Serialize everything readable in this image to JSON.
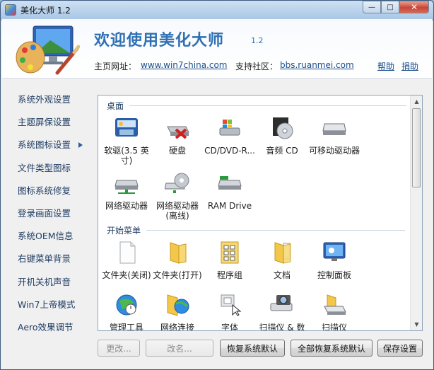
{
  "window": {
    "title": "美化大师 1.2",
    "controls": {
      "minimize": "—",
      "maximize": "□",
      "close": "✕"
    }
  },
  "banner": {
    "title": "欢迎使用美化大师",
    "version": "1.2",
    "home_label": "主页网址：",
    "home_url": "www.win7china.com",
    "community_label": "支持社区：",
    "community_url": "bbs.ruanmei.com",
    "help": "帮助",
    "donate": "捐助"
  },
  "sidebar": {
    "items": [
      {
        "label": "系统外观设置",
        "active": false
      },
      {
        "label": "主题屏保设置",
        "active": false
      },
      {
        "label": "系统图标设置",
        "active": true
      },
      {
        "label": "文件类型图标",
        "active": false
      },
      {
        "label": "图标系统修复",
        "active": false
      },
      {
        "label": "登录画面设置",
        "active": false
      },
      {
        "label": "系统OEM信息",
        "active": false
      },
      {
        "label": "右键菜单背景",
        "active": false
      },
      {
        "label": "开机关机声音",
        "active": false
      },
      {
        "label": "Win7上帝模式",
        "active": false
      },
      {
        "label": "Aero效果调节",
        "active": false
      }
    ]
  },
  "panel": {
    "desktop_section": "桌面",
    "start_section": "开始菜单",
    "desktop_items": [
      {
        "label": "软驱(3.5 英寸)",
        "icon": "floppy-drive-icon"
      },
      {
        "label": "硬盘",
        "icon": "hard-disk-icon"
      },
      {
        "label": "CD/DVD-R...",
        "icon": "cd-dvd-drive-icon"
      },
      {
        "label": "音频 CD",
        "icon": "audio-cd-icon"
      },
      {
        "label": "可移动驱动器",
        "icon": "removable-drive-icon"
      },
      {
        "label": "网络驱动器",
        "icon": "network-drive-icon"
      },
      {
        "label": "网络驱动器(离线)",
        "icon": "offline-network-drive-icon"
      },
      {
        "label": "RAM Drive",
        "icon": "ram-drive-icon"
      }
    ],
    "start_items": [
      {
        "label": "文件夹(关闭)",
        "icon": "document-icon"
      },
      {
        "label": "文件夹(打开)",
        "icon": "folder-open-icon"
      },
      {
        "label": "程序组",
        "icon": "program-group-icon"
      },
      {
        "label": "文档",
        "icon": "documents-folder-icon"
      },
      {
        "label": "控制面板",
        "icon": "control-panel-icon"
      },
      {
        "label": "管理工具",
        "icon": "admin-tools-icon"
      },
      {
        "label": "网络连接",
        "icon": "network-connections-icon"
      },
      {
        "label": "字体",
        "icon": "fonts-icon"
      },
      {
        "label": "扫描仪 & 数码相机",
        "icon": "scanner-camera-icon"
      },
      {
        "label": "扫描仪",
        "icon": "scanner-icon"
      }
    ]
  },
  "buttons": {
    "change": "更改...",
    "rename": "改名...",
    "restore_default": "恢复系统默认",
    "restore_all": "全部恢复系统默认",
    "save": "保存设置"
  }
}
